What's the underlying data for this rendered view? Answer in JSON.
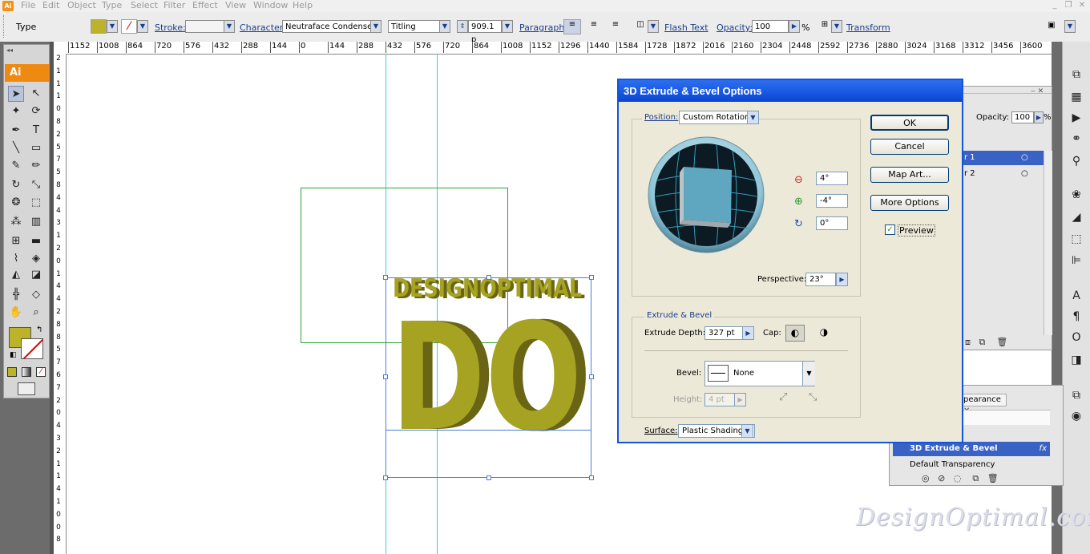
{
  "menu": {
    "app_icon": "Ai",
    "items": [
      "File",
      "Edit",
      "Object",
      "Type",
      "Select",
      "Filter",
      "Effect",
      "View",
      "Window",
      "Help"
    ]
  },
  "control_bar": {
    "mode": "Type",
    "stroke_label": "Stroke:",
    "character_label": "Character:",
    "font_family": "Neutraface Condense",
    "font_style": "Titling",
    "font_size": "909.1 p",
    "paragraph_label": "Paragraph:",
    "flash_text_label": "Flash Text",
    "opacity_label": "Opacity:",
    "opacity_value": "100",
    "percent": "%",
    "transform_label": "Transform",
    "fill_color": "#bcb32a"
  },
  "rulers": {
    "top": [
      "1152",
      "1008",
      "864",
      "720",
      "576",
      "432",
      "288",
      "144",
      "0",
      "144",
      "288",
      "432",
      "576",
      "720",
      "864",
      "1008",
      "1152",
      "1296",
      "1440",
      "1584",
      "1728",
      "1872",
      "2016",
      "2160",
      "2304",
      "2448",
      "2592",
      "2736",
      "2880",
      "3024",
      "3168",
      "3312",
      "3456",
      "3600"
    ],
    "left": [
      "2",
      "1",
      "1",
      "1",
      "0",
      "8",
      "2",
      "5",
      "7",
      "5",
      "8",
      "4",
      "4",
      "3",
      "1",
      "2",
      "0",
      "1",
      "4",
      "4",
      "2",
      "8",
      "8",
      "5",
      "7",
      "6",
      "7",
      "2",
      "0",
      "4",
      "3",
      "2",
      "1",
      "1",
      "4",
      "1",
      "0",
      "0",
      "8"
    ]
  },
  "tools": {
    "logo": "Ai"
  },
  "artwork": {
    "top_text": "DESIGNOPTIMAL",
    "big_text": "DO",
    "text_color": "#a6a322",
    "shadow_color": "#6a6514"
  },
  "dialog": {
    "title": "3D Extrude & Bevel Options",
    "position_label": "Position:",
    "position_value": "Custom Rotation",
    "rot_x": "4°",
    "rot_y": "-4°",
    "rot_z": "0°",
    "perspective_label": "Perspective:",
    "perspective_value": "23°",
    "extrude_group": "Extrude & Bevel",
    "extrude_depth_label": "Extrude Depth:",
    "extrude_depth_value": "327 pt",
    "cap_label": "Cap:",
    "bevel_label": "Bevel:",
    "bevel_value": "None",
    "height_label": "Height:",
    "height_value": "4 pt",
    "surface_label": "Surface:",
    "surface_value": "Plastic Shading",
    "buttons": {
      "ok": "OK",
      "cancel": "Cancel",
      "map_art": "Map Art...",
      "more_options": "More Options"
    },
    "preview_label": "Preview",
    "preview_checked": true
  },
  "layers_panel": {
    "opacity_label": "Opacity:",
    "opacity_value": "100",
    "percent": "%",
    "layer1": "r 1",
    "layer2": "r 2"
  },
  "appearance_panel": {
    "tab": "pearance",
    "item_selected": "3D Extrude & Bevel",
    "fx": "fx",
    "item2": "Default Transparency"
  },
  "watermark": "DesignOptimal.com"
}
